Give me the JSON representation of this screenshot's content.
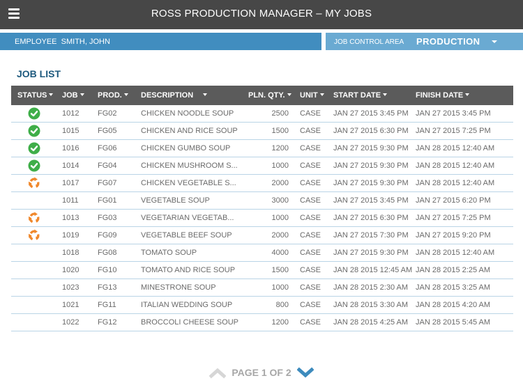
{
  "header": {
    "title": "ROSS PRODUCTION MANAGER – MY JOBS",
    "menu_icon": "hamburger-menu-icon"
  },
  "employee_bar": {
    "label": "EMPLOYEE",
    "value": "SMITH, JOHN"
  },
  "job_control_area": {
    "label": "JOB CONTROL AREA",
    "value": "PRODUCTION"
  },
  "job_list": {
    "title": "JOB LIST",
    "columns": [
      {
        "key": "status",
        "label": "STATUS"
      },
      {
        "key": "job",
        "label": "JOB"
      },
      {
        "key": "prod",
        "label": "PROD."
      },
      {
        "key": "description",
        "label": "DESCRIPTION"
      },
      {
        "key": "qty",
        "label": "PLN. QTY."
      },
      {
        "key": "unit",
        "label": "UNIT"
      },
      {
        "key": "start",
        "label": "START DATE"
      },
      {
        "key": "finish",
        "label": "FINISH DATE"
      }
    ],
    "rows": [
      {
        "status": "complete",
        "job": "1012",
        "prod": "FG02",
        "description": "CHICKEN NOODLE SOUP",
        "qty": "2500",
        "unit": "CASE",
        "start": "JAN 27 2015 3:45 PM",
        "finish": "JAN 27 2015 3:45 PM"
      },
      {
        "status": "complete",
        "job": "1015",
        "prod": "FG05",
        "description": "CHICKEN AND RICE SOUP",
        "qty": "1500",
        "unit": "CASE",
        "start": "JAN 27 2015 6:30 PM",
        "finish": "JAN 27 2015 7:25 PM"
      },
      {
        "status": "complete",
        "job": "1016",
        "prod": "FG06",
        "description": "CHICKEN GUMBO SOUP",
        "qty": "1200",
        "unit": "CASE",
        "start": "JAN 27 2015 9:30 PM",
        "finish": "JAN 28 2015 12:40 AM"
      },
      {
        "status": "complete",
        "job": "1014",
        "prod": "FG04",
        "description": "CHICKEN MUSHROOM S...",
        "qty": "1000",
        "unit": "CASE",
        "start": "JAN 27 2015 9:30 PM",
        "finish": "JAN 28 2015 12:40 AM"
      },
      {
        "status": "in-progress",
        "job": "1017",
        "prod": "FG07",
        "description": "CHICKEN VEGETABLE S...",
        "qty": "2000",
        "unit": "CASE",
        "start": "JAN 27 2015 9:30 PM",
        "finish": "JAN 28 2015 12:40 AM"
      },
      {
        "status": "none",
        "job": "1011",
        "prod": "FG01",
        "description": "VEGETABLE SOUP",
        "qty": "3000",
        "unit": "CASE",
        "start": "JAN 27 2015 3:45 PM",
        "finish": "JAN 27 2015 6:20 PM"
      },
      {
        "status": "in-progress",
        "job": "1013",
        "prod": "FG03",
        "description": "VEGETARIAN VEGETAB...",
        "qty": "1000",
        "unit": "CASE",
        "start": "JAN 27 2015 6:30 PM",
        "finish": "JAN 27 2015 7:25 PM"
      },
      {
        "status": "in-progress",
        "job": "1019",
        "prod": "FG09",
        "description": "VEGETABLE BEEF SOUP",
        "qty": "2000",
        "unit": "CASE",
        "start": "JAN 27 2015 7:30 PM",
        "finish": "JAN 27 2015 9:20 PM"
      },
      {
        "status": "none",
        "job": "1018",
        "prod": "FG08",
        "description": "TOMATO SOUP",
        "qty": "4000",
        "unit": "CASE",
        "start": "JAN 27 2015 9:30 PM",
        "finish": "JAN 28 2015 12:40 AM"
      },
      {
        "status": "none",
        "job": "1020",
        "prod": "FG10",
        "description": "TOMATO AND RICE SOUP",
        "qty": "1500",
        "unit": "CASE",
        "start": "JAN 28 2015 12:45 AM",
        "finish": "JAN 28 2015 2:25 AM"
      },
      {
        "status": "none",
        "job": "1023",
        "prod": "FG13",
        "description": "MINESTRONE SOUP",
        "qty": "1000",
        "unit": "CASE",
        "start": "JAN 28 2015 2:30 AM",
        "finish": "JAN 28 2015 3:25 AM"
      },
      {
        "status": "none",
        "job": "1021",
        "prod": "FG11",
        "description": "ITALIAN WEDDING SOUP",
        "qty": "800",
        "unit": "CASE",
        "start": "JAN 28 2015 3:30 AM",
        "finish": "JAN 28 2015 4:20 AM"
      },
      {
        "status": "none",
        "job": "1022",
        "prod": "FG12",
        "description": "BROCCOLI CHEESE SOUP",
        "qty": "1200",
        "unit": "CASE",
        "start": "JAN 28 2015 4:25 AM",
        "finish": "JAN 28 2015 5:45 AM"
      }
    ]
  },
  "pagination": {
    "label": "PAGE 1 OF 2",
    "current_page": 1,
    "total_pages": 2,
    "prev_enabled": false,
    "next_enabled": true
  },
  "colors": {
    "header_bg": "#474747",
    "employee_bar": "#418dbf",
    "job_control_bar": "#6aaad2",
    "title_text": "#1e5a7e",
    "table_header": "#5b5b5b",
    "row_divider": "#b9d4e6",
    "status_complete": "#3fae49",
    "status_in_progress": "#f0882c",
    "pager_active": "#3d8bbd",
    "pager_disabled": "#d6d6d6"
  }
}
